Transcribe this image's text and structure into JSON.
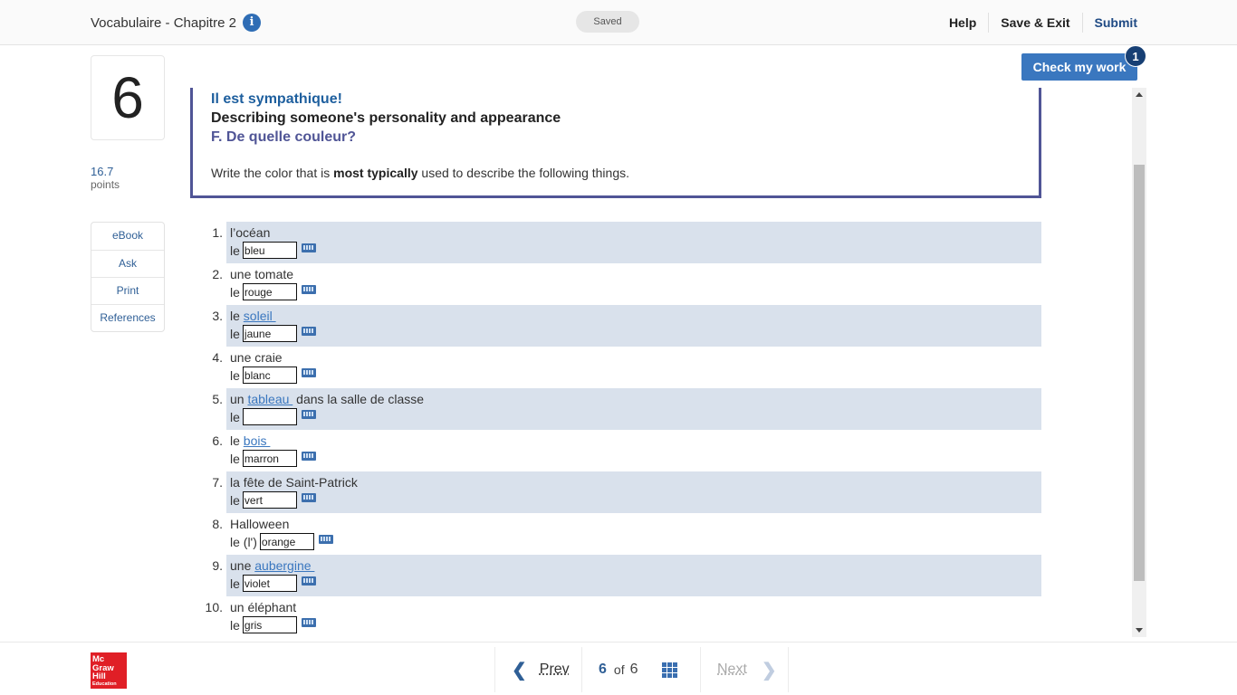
{
  "header": {
    "title": "Vocabulaire - Chapitre 2",
    "info_icon": "i",
    "status": "Saved",
    "nav": {
      "help": "Help",
      "save_exit": "Save & Exit",
      "submit": "Submit"
    }
  },
  "sidebar": {
    "question_number": "6",
    "points_value": "16.7",
    "points_label": "points",
    "tools": [
      {
        "label": "eBook"
      },
      {
        "label": "Ask"
      },
      {
        "label": "Print"
      },
      {
        "label": "References"
      }
    ]
  },
  "check": {
    "label": "Check my work",
    "badge": "1"
  },
  "question": {
    "line1": "Il est sympathique!",
    "line2": "Describing someone's personality and appearance",
    "line3": "F. De quelle couleur?",
    "instruction_pre": "Write the color that is ",
    "instruction_bold": "most typically",
    "instruction_post": " used to describe the following things.",
    "items": [
      {
        "num": "1.",
        "prompt_pre": "l’océan",
        "link": "",
        "prompt_post": "",
        "answer_prefix": "le",
        "value": "bleu"
      },
      {
        "num": "2.",
        "prompt_pre": "une tomate",
        "link": "",
        "prompt_post": "",
        "answer_prefix": "le",
        "value": "rouge"
      },
      {
        "num": "3.",
        "prompt_pre": "le ",
        "link": "soleil ",
        "prompt_post": "",
        "answer_prefix": "le",
        "value": "jaune"
      },
      {
        "num": "4.",
        "prompt_pre": "une craie",
        "link": "",
        "prompt_post": "",
        "answer_prefix": "le",
        "value": "blanc"
      },
      {
        "num": "5.",
        "prompt_pre": "un ",
        "link": "tableau ",
        "prompt_post": " dans la salle de classe",
        "answer_prefix": "le",
        "value": ""
      },
      {
        "num": "6.",
        "prompt_pre": "le ",
        "link": "bois ",
        "prompt_post": "",
        "answer_prefix": "le",
        "value": "marron"
      },
      {
        "num": "7.",
        "prompt_pre": "la fête de Saint-Patrick",
        "link": "",
        "prompt_post": "",
        "answer_prefix": "le",
        "value": "vert"
      },
      {
        "num": "8.",
        "prompt_pre": "Halloween",
        "link": "",
        "prompt_post": "",
        "answer_prefix": "le (l')",
        "value": "orange"
      },
      {
        "num": "9.",
        "prompt_pre": "une ",
        "link": "aubergine ",
        "prompt_post": "",
        "answer_prefix": "le",
        "value": "violet"
      },
      {
        "num": "10.",
        "prompt_pre": "un éléphant",
        "link": "",
        "prompt_post": "",
        "answer_prefix": "le",
        "value": "gris"
      }
    ]
  },
  "footer": {
    "logo_lines": [
      "Mc",
      "Graw",
      "Hill",
      "Education"
    ],
    "prev": "Prev",
    "current": "6",
    "of": "of",
    "total": "6",
    "next": "Next"
  },
  "colors": {
    "brand_blue": "#3a77bf",
    "card_border": "#505596",
    "row_shade": "#d9e1ec",
    "logo_red": "#e01f26"
  }
}
